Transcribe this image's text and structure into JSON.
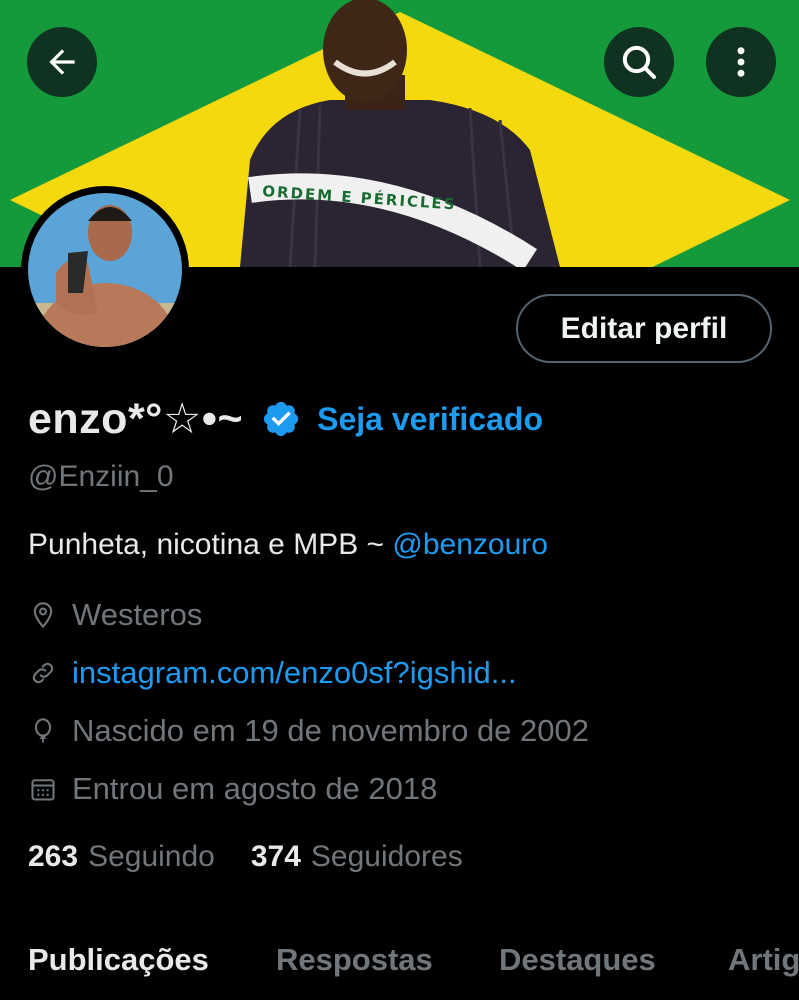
{
  "banner": {
    "flag_text": "ORDEM E PÉRICLES",
    "colors": {
      "green": "#159a3b",
      "yellow": "#f5d90f",
      "shirt": "#2b2433"
    }
  },
  "header": {
    "back_icon": "arrow-left-icon",
    "search_icon": "search-icon",
    "more_icon": "more-vertical-icon"
  },
  "profile": {
    "edit_button_label": "Editar perfil",
    "display_name": "enzo*°☆•~",
    "verified_icon": "verified-badge-icon",
    "verify_link": "Seja verificado",
    "handle": "@Enziin_0",
    "bio_text": "Punheta, nicotina e MPB ~ ",
    "bio_mention": "@benzouro",
    "location": "Westeros",
    "website": "instagram.com/enzo0sf?igshid...",
    "birth": "Nascido em 19 de novembro de 2002",
    "joined": "Entrou em agosto de 2018"
  },
  "stats": {
    "following_count": "263",
    "following_label": "Seguindo",
    "followers_count": "374",
    "followers_label": "Seguidores"
  },
  "tabs": [
    {
      "label": "Publicações",
      "active": true
    },
    {
      "label": "Respostas",
      "active": false
    },
    {
      "label": "Destaques",
      "active": false
    },
    {
      "label": "Artig",
      "active": false
    }
  ],
  "colors": {
    "accent": "#1d9bf0",
    "secondary_text": "#71767b",
    "primary_text": "#e7e9ea",
    "background": "#000000"
  }
}
